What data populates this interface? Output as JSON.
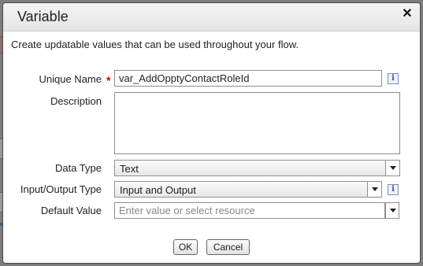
{
  "dialog": {
    "title": "Variable",
    "close_icon": "close-icon",
    "intro": "Create updatable values that can be used throughout your flow."
  },
  "fields": {
    "unique_name": {
      "label": "Unique Name",
      "value": "var_AddOpptyContactRoleId",
      "required": true
    },
    "description": {
      "label": "Description",
      "value": ""
    },
    "data_type": {
      "label": "Data Type",
      "value": "Text"
    },
    "io_type": {
      "label": "Input/Output Type",
      "value": "Input and Output"
    },
    "default_value": {
      "label": "Default Value",
      "placeholder": "Enter value or select resource"
    }
  },
  "buttons": {
    "ok": "OK",
    "cancel": "Cancel"
  },
  "colors": {
    "required": "#cc0000",
    "info_icon": "#2b5aa6"
  }
}
